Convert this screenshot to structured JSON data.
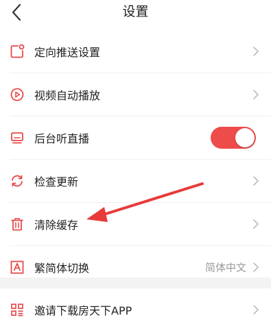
{
  "header": {
    "title": "设置"
  },
  "items": [
    {
      "label": "定向推送设置",
      "icon": "push-notification-icon"
    },
    {
      "label": "视频自动播放",
      "icon": "play-circle-icon"
    },
    {
      "label": "后台听直播",
      "icon": "monitor-icon",
      "toggle_on": true
    },
    {
      "label": "检查更新",
      "icon": "refresh-icon"
    },
    {
      "label": "清除缓存",
      "icon": "trash-icon"
    },
    {
      "label": "繁简体切换",
      "icon": "letter-a-icon",
      "value": "简体中文"
    },
    {
      "label": "邀请下载房天下APP",
      "icon": "qr-code-icon"
    }
  ],
  "colors": {
    "accent": "#ee4b4b",
    "annotation_arrow": "#e83a3a"
  }
}
